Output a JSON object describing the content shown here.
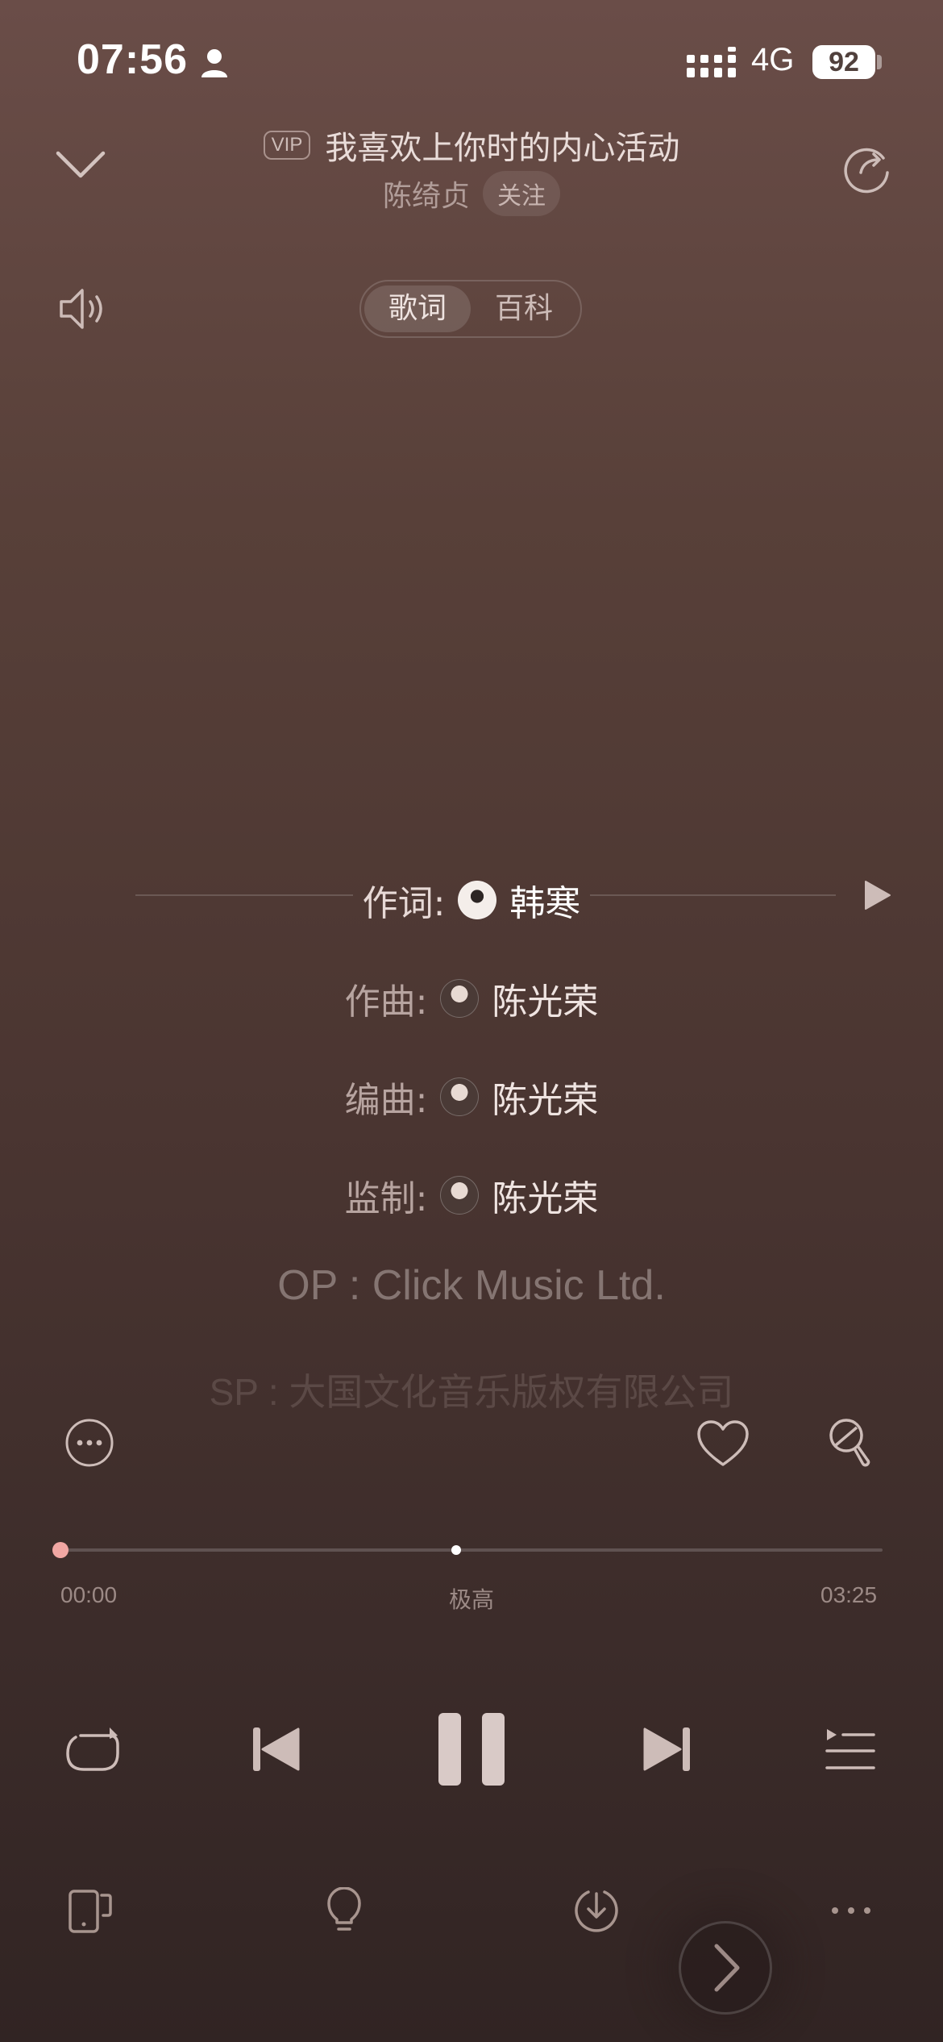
{
  "status_bar": {
    "time": "07:56",
    "network": "4G",
    "battery": "92"
  },
  "header": {
    "vip_badge": "VIP",
    "song_title": "我喜欢上你时的内心活动",
    "artist": "陈绮贞",
    "follow_label": "关注"
  },
  "tabs": [
    {
      "label": "歌词",
      "active": true
    },
    {
      "label": "百科",
      "active": false
    }
  ],
  "credits": [
    {
      "role": "作词:",
      "name": "韩寒",
      "current": true
    },
    {
      "role": "作曲:",
      "name": "陈光荣",
      "current": false
    },
    {
      "role": "编曲:",
      "name": "陈光荣",
      "current": false
    },
    {
      "role": "监制:",
      "name": "陈光荣",
      "current": false
    }
  ],
  "lyrics_extra": {
    "op": "OP : Click Music Ltd.",
    "sp": "SP : 大国文化音乐版权有限公司"
  },
  "player": {
    "time_current": "00:00",
    "time_total": "03:25",
    "quality": "极高",
    "progress_fraction": 0.0
  },
  "colors": {
    "accent_progress": "#f1a7a3",
    "background_top": "#6a4d48",
    "background_bottom": "#312423"
  },
  "icons": {
    "collapse": "chevron-down-icon",
    "share": "share-icon",
    "volume": "volume-icon",
    "guide_play": "play-icon",
    "more_circle": "more-circle-icon",
    "like": "heart-icon",
    "mic": "microphone-icon",
    "repeat": "repeat-icon",
    "prev": "previous-icon",
    "pause": "pause-icon",
    "next": "next-icon",
    "playlist": "playlist-icon",
    "device": "device-icon",
    "bulb": "bulb-icon",
    "download": "download-icon",
    "more": "more-icon",
    "floating_next": "chevron-right-icon"
  }
}
